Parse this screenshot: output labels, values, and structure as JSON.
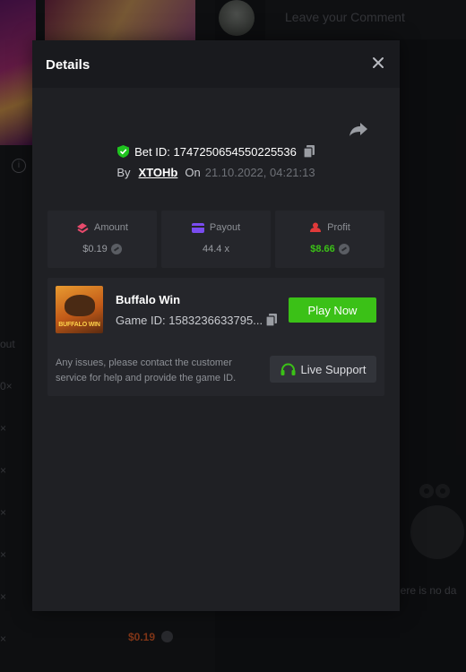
{
  "background": {
    "comment_placeholder": "Leave your Comment",
    "column_fragment": "out",
    "multiplier_suffix": "0×",
    "row_suffix": "×",
    "amount": "$0.19",
    "no_data": "here is no da"
  },
  "modal": {
    "title": "Details",
    "bet_id": "Bet ID: 1747250654550225536",
    "by_label": "By",
    "user": "XTOHb",
    "on_label": "On",
    "date": "21.10.2022, 04:21:13",
    "stats": [
      {
        "label": "Amount",
        "value": "$0.19"
      },
      {
        "label": "Payout",
        "value": "44.4 x"
      },
      {
        "label": "Profit",
        "value": "$8.66"
      }
    ],
    "game": {
      "name": "Buffalo Win",
      "id": "Game ID: 1583236633795...",
      "thumb_text": "BUFFALO WIN",
      "play_label": "Play Now"
    },
    "support_text": "Any issues, please contact the customer service for help and provide the game ID.",
    "live_support_label": "Live Support"
  },
  "colors": {
    "accent_green": "#3bc117",
    "shield_green": "#1fc41f",
    "amount_icon": "#e84a6c",
    "payout_icon": "#7a4cf0",
    "profit_icon": "#e03a3a"
  }
}
